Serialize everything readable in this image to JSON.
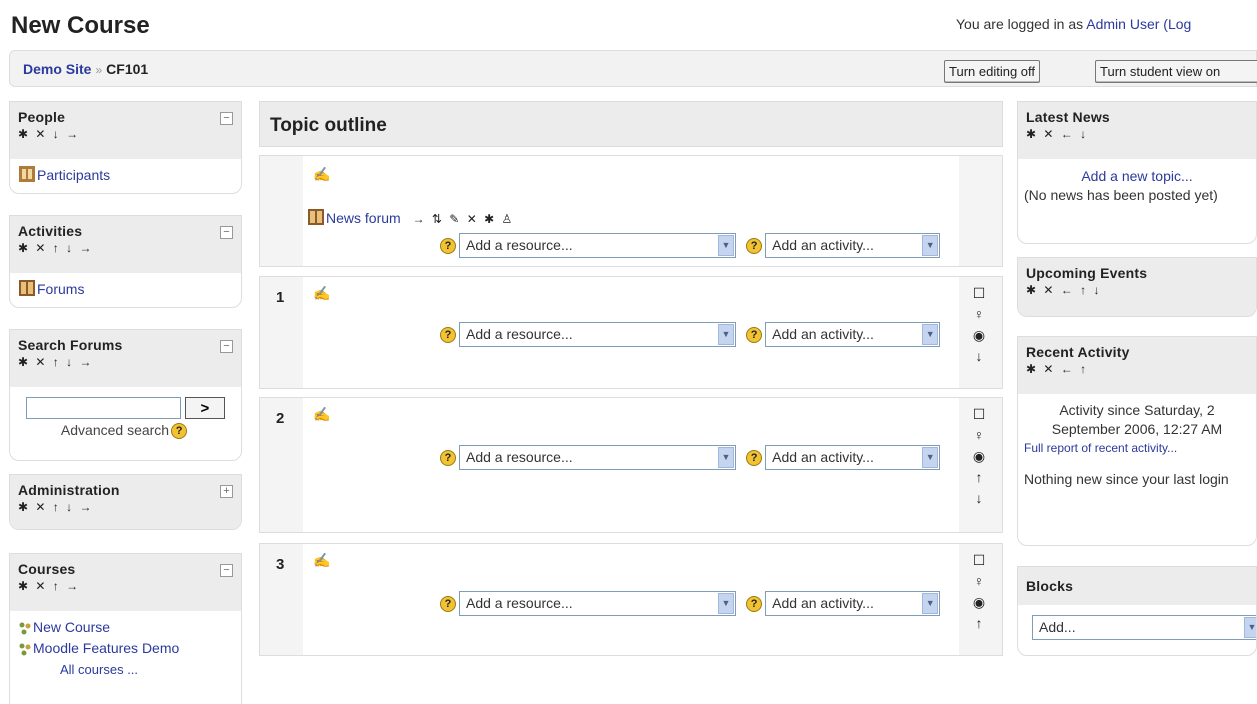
{
  "header": {
    "title": "New Course",
    "login_prefix": "You are logged in as ",
    "login_user": "Admin User (Log"
  },
  "navbar": {
    "crumb_home": "Demo Site",
    "crumb_sep": "»",
    "crumb_course": "CF101",
    "btn_edit": "Turn editing off",
    "btn_student": "Turn student view on"
  },
  "left_blocks": {
    "people": {
      "title": "People",
      "controls": "✱ ✕ ↓ →",
      "items": [
        "Participants"
      ]
    },
    "activities": {
      "title": "Activities",
      "controls": "✱ ✕ ↑ ↓ →",
      "items": [
        "Forums"
      ]
    },
    "search_forums": {
      "title": "Search Forums",
      "controls": "✱ ✕ ↑ ↓ →",
      "button": ">",
      "advanced": "Advanced search"
    },
    "administration": {
      "title": "Administration",
      "controls": "✱ ✕ ↑ ↓ →"
    },
    "courses": {
      "title": "Courses",
      "controls": "✱ ✕ ↑ →",
      "items": [
        "New Course",
        "Moodle Features Demo"
      ],
      "all_courses": "All courses ..."
    }
  },
  "main": {
    "title": "Topic outline",
    "news_forum": "News forum",
    "news_controls": "→ ⇅ ✎ ✕ ✱ ♙",
    "add_resource": "Add a resource...",
    "add_activity": "Add an activity...",
    "sections": [
      {
        "num": "1"
      },
      {
        "num": "2"
      },
      {
        "num": "3"
      }
    ]
  },
  "right_blocks": {
    "latest_news": {
      "title": "Latest News",
      "controls": "✱ ✕ ← ↓",
      "add_topic": "Add a new topic...",
      "empty": "(No news has been posted yet)"
    },
    "upcoming_events": {
      "title": "Upcoming Events",
      "controls": "✱ ✕ ← ↑ ↓"
    },
    "recent_activity": {
      "title": "Recent Activity",
      "controls": "✱ ✕ ← ↑",
      "since": "Activity since Saturday, 2 September 2006, 12:27 AM",
      "full_report": "Full report of recent activity...",
      "nothing_new": "Nothing new since your last login"
    },
    "blocks": {
      "title": "Blocks",
      "add": "Add..."
    }
  }
}
